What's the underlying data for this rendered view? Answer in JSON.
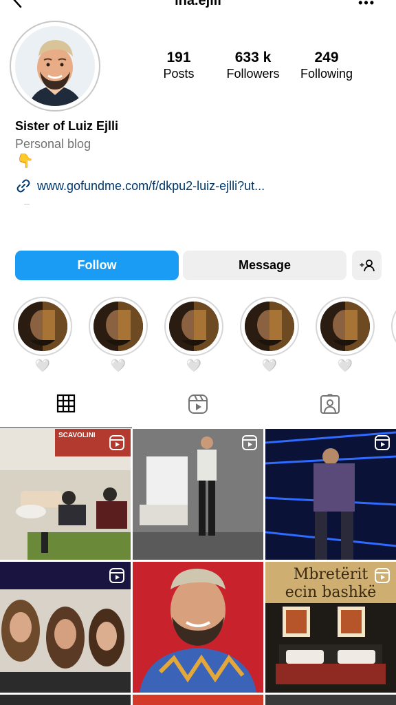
{
  "header": {
    "username": "ina.ejlli"
  },
  "profile": {
    "stats": {
      "posts": {
        "value": "191",
        "label": "Posts"
      },
      "followers": {
        "value": "633 k",
        "label": "Followers"
      },
      "following": {
        "value": "249",
        "label": "Following"
      }
    },
    "name": "Sister of Luiz Ejlli",
    "category": "Personal blog",
    "bio_emoji": "👇",
    "link": "www.gofundme.com/f/dkpu2-luiz-ejlli?ut..."
  },
  "actions": {
    "follow_label": "Follow",
    "message_label": "Message",
    "follow_color": "#1a9cf5"
  },
  "highlights": [
    {
      "label": "🤍"
    },
    {
      "label": "🤍"
    },
    {
      "label": "🤍"
    },
    {
      "label": "🤍"
    },
    {
      "label": "🤍"
    }
  ],
  "tabs": [
    {
      "icon": "grid-icon",
      "active": true
    },
    {
      "icon": "reels-icon",
      "active": false
    },
    {
      "icon": "tagged-icon",
      "active": false
    }
  ],
  "grid": {
    "tiles": [
      {
        "type": "reel",
        "text": "SCAVOLINI"
      },
      {
        "type": "reel"
      },
      {
        "type": "reel"
      },
      {
        "type": "reel"
      },
      {
        "type": "photo"
      },
      {
        "type": "reel",
        "text_line1": "Mbretërit",
        "text_line2": "ecin bashkë"
      }
    ]
  }
}
